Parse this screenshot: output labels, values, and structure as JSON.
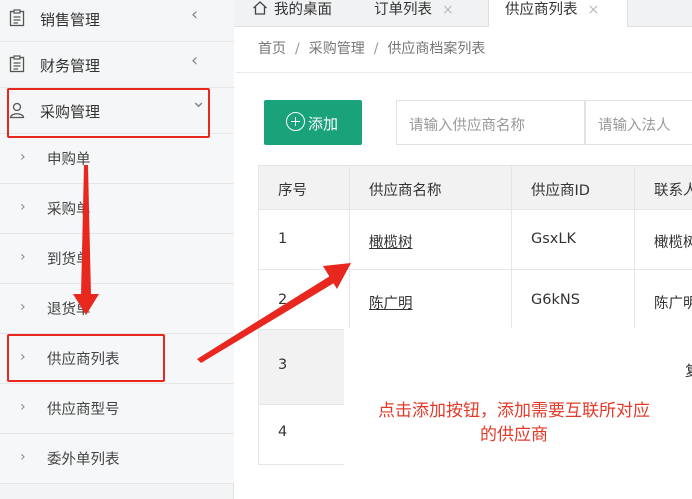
{
  "sidebar": {
    "menus": [
      {
        "label": "销售管理",
        "icon": "clipboard-icon",
        "arrow": "‹"
      },
      {
        "label": "财务管理",
        "icon": "clipboard-icon",
        "arrow": "‹"
      },
      {
        "label": "采购管理",
        "icon": "user-icon",
        "arrow": "⌄"
      }
    ],
    "subitems": [
      {
        "label": "申购单"
      },
      {
        "label": "采购单"
      },
      {
        "label": "到货单"
      },
      {
        "label": "退货单"
      },
      {
        "label": "供应商列表"
      },
      {
        "label": "供应商型号"
      },
      {
        "label": "委外单列表"
      }
    ]
  },
  "tabs": [
    {
      "label": "我的桌面",
      "icon": "home-icon"
    },
    {
      "label": "订单列表",
      "close": "×"
    },
    {
      "label": "供应商列表",
      "close": "×",
      "active": true
    }
  ],
  "breadcrumb": {
    "items": [
      "首页",
      "采购管理",
      "供应商档案列表"
    ],
    "separator": "/"
  },
  "toolbar": {
    "add_label": "添加",
    "supplier_placeholder": "请输入供应商名称",
    "legal_placeholder": "请输入法人"
  },
  "table": {
    "headers": [
      "序号",
      "供应商名称",
      "供应商ID",
      "联系人"
    ],
    "rows": [
      {
        "no": "1",
        "name": "橄榄树",
        "id": "GsxLK",
        "contact": "橄榄树"
      },
      {
        "no": "2",
        "name": "陈广明",
        "id": "G6kNS",
        "contact": "陈广明"
      },
      {
        "no": "3",
        "partial": "复"
      },
      {
        "no": "4"
      }
    ]
  },
  "annotation": {
    "text_line1": "点击添加按钮，添加需要互联所对应",
    "text_line2": "的供应商",
    "color": "#e8271f"
  },
  "colors": {
    "accent": "#1aa27a",
    "annotation": "#e8271f"
  }
}
